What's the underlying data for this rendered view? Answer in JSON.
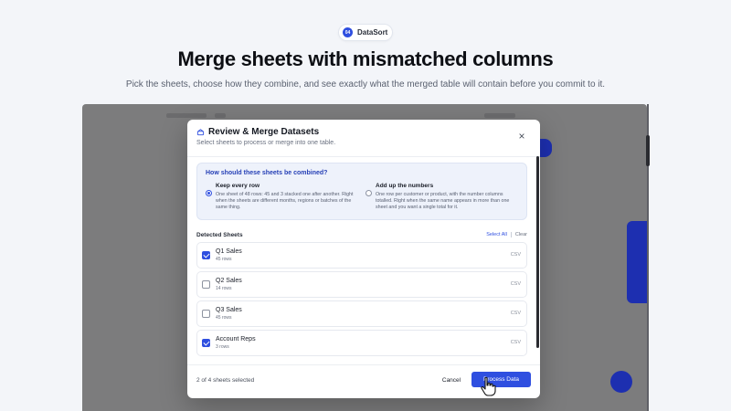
{
  "brand": {
    "logo_text": "04",
    "name": "DataSort",
    "accent": "#2f4fe0"
  },
  "hero": {
    "title": "Merge sheets with mismatched columns",
    "subtitle": "Pick the sheets, choose how they combine, and see exactly what the merged table will contain before you commit to it."
  },
  "modal": {
    "icon": "stack-icon",
    "title": "Review & Merge Datasets",
    "subtitle": "Select sheets to process or merge into one table.",
    "close_label": "×",
    "combine": {
      "question": "How should these sheets be combined?",
      "options": [
        {
          "title": "Keep every row",
          "description": "One sheet of 48 rows: 45 and 3 stacked one after another. Right when the sheets are different months, regions or batches of the same thing.",
          "selected": true
        },
        {
          "title": "Add up the numbers",
          "description": "One row per customer or product, with the number columns totalled. Right when the same name appears in more than one sheet and you want a single total for it.",
          "selected": false
        }
      ]
    },
    "sheets": {
      "label": "Detected Sheets",
      "select_all": "Select All",
      "clear": "Clear",
      "items": [
        {
          "name": "Q1 Sales",
          "rows": "45 rows",
          "type": "CSV",
          "checked": true
        },
        {
          "name": "Q2 Sales",
          "rows": "14 rows",
          "type": "CSV",
          "checked": false
        },
        {
          "name": "Q3 Sales",
          "rows": "45 rows",
          "type": "CSV",
          "checked": false
        },
        {
          "name": "Account Reps",
          "rows": "3 rows",
          "type": "CSV",
          "checked": true
        }
      ]
    },
    "footer": {
      "count": "2 of 4 sheets selected",
      "cancel": "Cancel",
      "process": "Process Data"
    }
  }
}
